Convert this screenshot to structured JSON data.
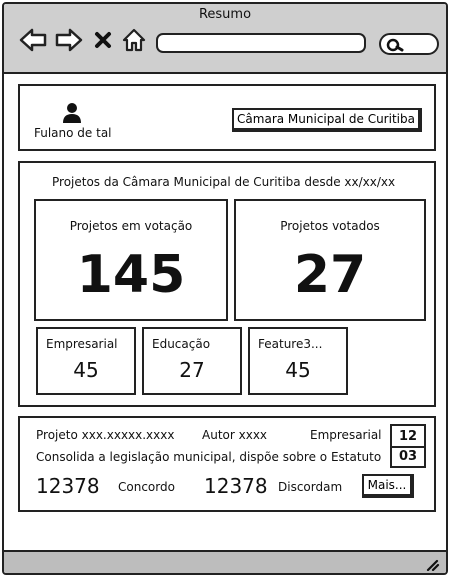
{
  "window": {
    "title": "Resumo"
  },
  "browser": {
    "back_icon": "arrow-left-icon",
    "forward_icon": "arrow-right-icon",
    "close_icon": "x-icon",
    "home_icon": "home-icon",
    "search_icon": "search-icon",
    "address_value": ""
  },
  "user": {
    "name": "Fulano de tal",
    "icon": "user-icon"
  },
  "council_button": {
    "label": "Câmara Municipal de Curitiba"
  },
  "projects": {
    "heading": "Projetos da Câmara Municipal de Curitiba desde xx/xx/xx",
    "voting": {
      "label": "Projetos em votação",
      "value": "145"
    },
    "voted": {
      "label": "Projetos votados",
      "value": "27"
    },
    "categories": [
      {
        "label": "Empresarial",
        "value": "45"
      },
      {
        "label": "Educação",
        "value": "27"
      },
      {
        "label": "Feature3...",
        "value": "45"
      }
    ]
  },
  "project_item": {
    "project": "Projeto xxx.xxxxx.xxxx",
    "author": "Autor xxxx",
    "category": "Empresarial",
    "date_day": "12",
    "date_month": "03",
    "summary": "Consolida a legislação municipal, dispõe sobre o Estatuto...",
    "agree_count": "12378",
    "agree_label": "Concordo",
    "disagree_count": "12378",
    "disagree_label": "Discordam",
    "more_label": "Mais..."
  }
}
